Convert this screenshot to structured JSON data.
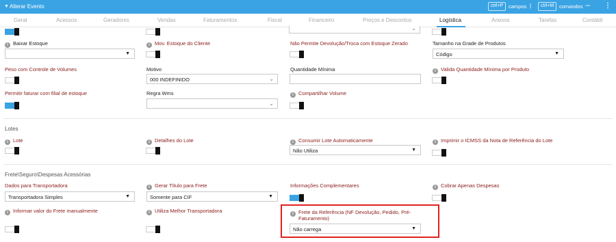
{
  "header": {
    "title": "Alterar Evento",
    "kbd1": "ctrl+P",
    "hint1": "campos",
    "kbd2": "ctrl+M",
    "hint2": "comandos",
    "sep": "|"
  },
  "tabs": [
    "Geral",
    "Acessos",
    "Geradores",
    "Vendas",
    "Faturamentos",
    "Fiscal",
    "Financeiro",
    "Preços e Descontos",
    "Logística",
    "Anexos",
    "Tarefas",
    "Contábil"
  ],
  "fields": {
    "baixar_estoque": "Baixar Estoque",
    "mov_estoque_cliente": "Mov. Estoque do Cliente",
    "nao_permite_devolucao": "Não Permite Devolução/Troca com Estoque Zerado",
    "tamanho_grade": "Tamanho na Grade de Produtos",
    "tamanho_grade_value": "Código",
    "peso_controle_volumes": "Peso com Controle de Volumes",
    "motivo": "Motivo",
    "motivo_value": "000 INDEFINIDO",
    "quantidade_minima": "Quantidade Mínima",
    "valida_qtd_minima": "Valida Quantidade Mínima por Produto",
    "permitir_faturar_filial": "Permitir faturar com filial de estoque",
    "regra_wms": "Regra Wms",
    "compartilhar_volume": "Compartilhar Volume"
  },
  "lotes": {
    "section_title": "Lotes",
    "lote": "Lote",
    "detalhes_lote": "Detalhes do Lote",
    "consumir_lote": "Consumir Lote Automaticamente",
    "consumir_lote_value": "Não Utiliza",
    "imprimir_icmss": "Imprimir o ICMSS da Nota de Referência do Lote"
  },
  "frete": {
    "section_title": "Frete\\Seguro\\Despesas Acessórias",
    "dados_transportadora": "Dados para Transportadora",
    "dados_transportadora_value": "Transportadora Simples",
    "gerar_titulo_frete": "Gerar Título para Frete",
    "gerar_titulo_frete_value": "Somente para CIF",
    "informacoes_complementares": "Informações Complementares",
    "cobrar_apenas_despesas": "Cobrar Apenas Despesas",
    "informar_valor_frete": "Informar valor do Frete manualmente",
    "utiliza_melhor_transportadora": "Utiliza Melhor Transportadora",
    "frete_referencia_line1": "Frete da Referência (NF Devolução, Pedido, Pré-",
    "frete_referencia_line2": "Faturamento)",
    "frete_referencia_value": "Não carrega"
  },
  "toggles": {
    "top_col1": true,
    "top_col2": false,
    "top_col4": false,
    "peso_controle_volumes": false,
    "valida_qtd_minima": false,
    "permitir_faturar_filial": true,
    "compartilhar_volume": false,
    "lote": false,
    "detalhes_lote": false,
    "imprimir_icmss": false,
    "informacoes_complementares": true,
    "cobrar_apenas_despesas": false,
    "informar_valor_frete": false,
    "utiliza_melhor_transportadora": false
  },
  "colors": {
    "accent": "#3aa3e3",
    "label_red": "#8b1a1a",
    "highlight": "#e02020"
  }
}
